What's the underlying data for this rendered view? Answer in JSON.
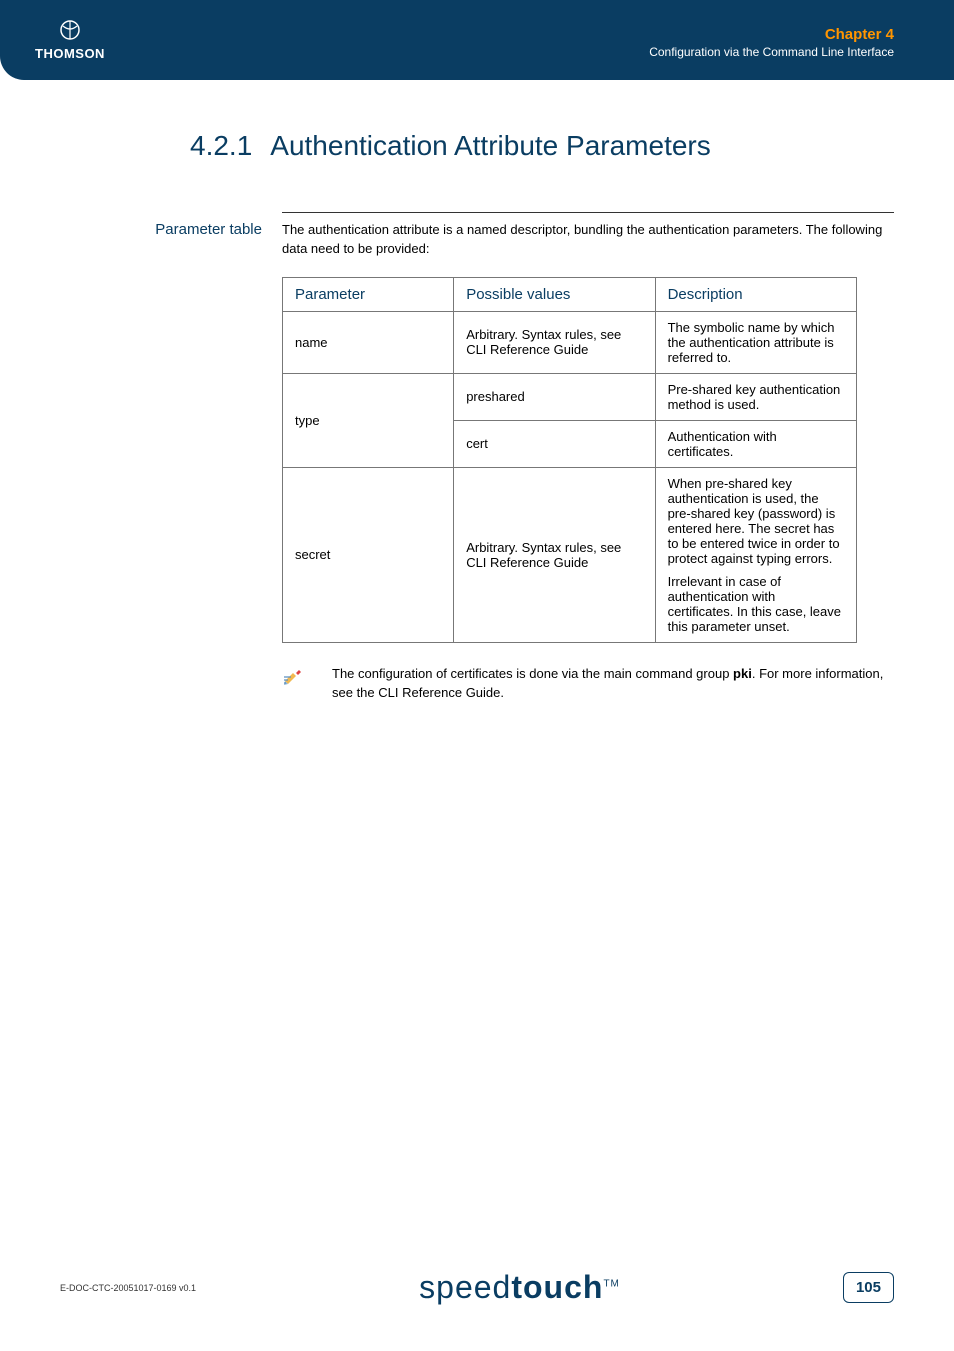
{
  "header": {
    "logo_text": "THOMSON",
    "chapter": "Chapter 4",
    "subtitle": "Configuration via the Command Line Interface"
  },
  "section": {
    "number": "4.2.1",
    "title": "Authentication Attribute Parameters",
    "side_label": "Parameter table",
    "intro": "The authentication attribute is a named descriptor, bundling the authentication parameters. The following data need to be provided:"
  },
  "table": {
    "head": {
      "param": "Parameter",
      "values": "Possible values",
      "desc": "Description"
    },
    "rows": {
      "name": {
        "param": "name",
        "values": "Arbitrary. Syntax rules, see CLI Reference Guide",
        "desc": "The symbolic name by which the authentication attribute is referred to."
      },
      "type": {
        "param": "type",
        "preshared_val": "preshared",
        "preshared_desc": "Pre-shared key authentication method is used.",
        "cert_val": "cert",
        "cert_desc": "Authentication with certificates."
      },
      "secret": {
        "param": "secret",
        "values": "Arbitrary. Syntax rules, see CLI Reference Guide",
        "desc1": "When pre-shared key authentication is used, the pre-shared key (password) is entered here. The secret has to be entered twice in order to protect against typing errors.",
        "desc2": "Irrelevant in case of authentication with certificates. In this case, leave this parameter unset."
      }
    }
  },
  "note": {
    "prefix": "The configuration of certificates is done via the main command group ",
    "bold": "pki",
    "suffix": ". For more information, see the CLI Reference Guide."
  },
  "footer": {
    "doc_id": "E-DOC-CTC-20051017-0169 v0.1",
    "brand_light": "speed",
    "brand_bold": "touch",
    "brand_tm": "TM",
    "page": "105"
  }
}
